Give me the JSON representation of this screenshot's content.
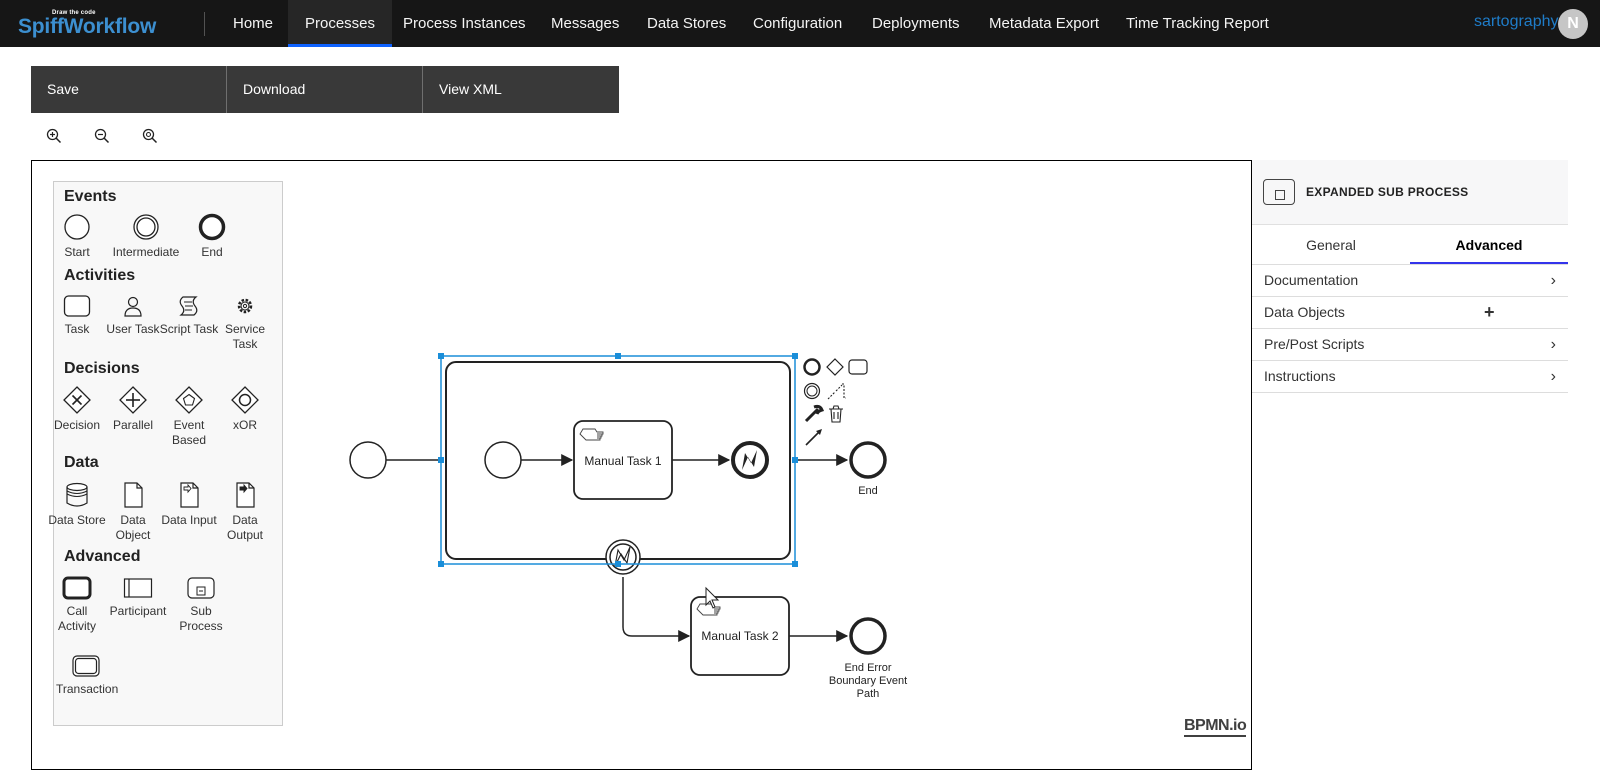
{
  "nav": {
    "logo_tag": "Draw the code",
    "logo_text": "SpiffWorkflow",
    "items": [
      "Home",
      "Processes",
      "Process Instances",
      "Messages",
      "Data Stores",
      "Configuration",
      "Deployments",
      "Metadata Export",
      "Time Tracking Report"
    ],
    "active": "Processes",
    "user": "sartography",
    "avatar_initial": "N"
  },
  "toolbar": {
    "save": "Save",
    "download": "Download",
    "view_xml": "View XML"
  },
  "zoom": [
    "zoom-in-icon",
    "zoom-out-icon",
    "zoom-fit-icon"
  ],
  "palette": {
    "events_header": "Events",
    "events": [
      "Start",
      "Intermediate",
      "End"
    ],
    "activities_header": "Activities",
    "activities": [
      "Task",
      "User Task",
      "Script Task",
      "Service Task"
    ],
    "decisions_header": "Decisions",
    "decisions": [
      "Decision",
      "Parallel",
      "Event Based",
      "xOR"
    ],
    "data_header": "Data",
    "data": [
      "Data Store",
      "Data Object",
      "Data Input",
      "Data Output"
    ],
    "advanced_header": "Advanced",
    "advanced": [
      "Call Activity",
      "Participant",
      "Sub Process",
      "Transaction"
    ]
  },
  "diagram": {
    "task1": "Manual Task 1",
    "task2": "Manual Task 2",
    "end_label": "End",
    "end_error_label_1": "End Error",
    "end_error_label_2": "Boundary Event",
    "end_error_label_3": "Path",
    "selection_color": "#1a8ed9"
  },
  "watermark": "BPMN.io",
  "properties": {
    "title": "EXPANDED SUB PROCESS",
    "tabs": [
      "General",
      "Advanced"
    ],
    "active_tab": "Advanced",
    "groups": [
      "Documentation",
      "Data Objects",
      "Pre/Post Scripts",
      "Instructions"
    ]
  }
}
